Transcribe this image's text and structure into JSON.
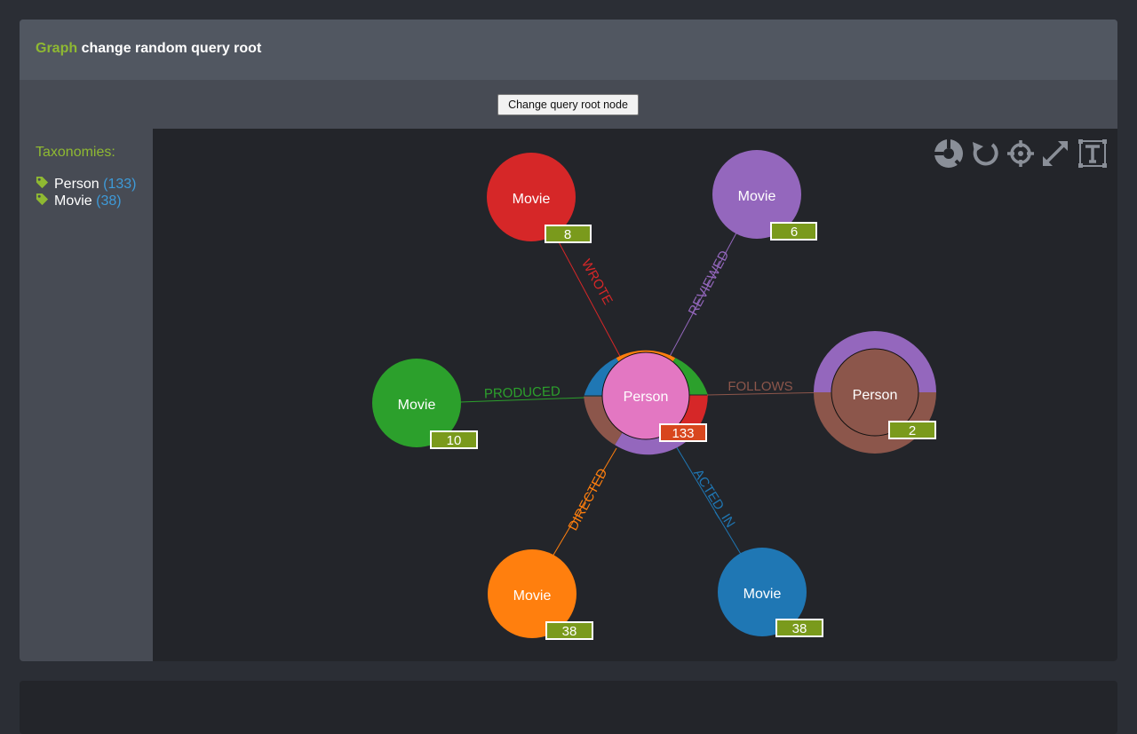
{
  "header": {
    "title_accent": "Graph",
    "title_rest": " change random query root"
  },
  "toolbar": {
    "change_root_label": "Change query root node"
  },
  "sidebar": {
    "title": "Taxonomies:",
    "items": [
      {
        "label": "Person",
        "count": "(133)"
      },
      {
        "label": "Movie",
        "count": "(38)"
      }
    ]
  },
  "colors": {
    "accent": "#8fb932",
    "count_link": "#3e9ad8",
    "badge": "#7a9a1c",
    "badge_root": "#d8461e",
    "red": "#d62728",
    "purple": "#9467bd",
    "green": "#2ca02c",
    "orange": "#ff7f0e",
    "blue": "#1f77b4",
    "brown": "#8c564b",
    "pink": "#e377c2"
  },
  "graph_controls": [
    "center-root-icon",
    "reset-icon",
    "locate-icon",
    "fullscreen-icon",
    "toggle-labels-icon"
  ],
  "graph": {
    "root": {
      "label": "Person",
      "count": "133"
    },
    "nodes": [
      {
        "label": "Movie",
        "count": "8",
        "color": "red"
      },
      {
        "label": "Movie",
        "count": "6",
        "color": "purple"
      },
      {
        "label": "Movie",
        "count": "10",
        "color": "green"
      },
      {
        "label": "Person",
        "count": "2",
        "color": "brown"
      },
      {
        "label": "Movie",
        "count": "38",
        "color": "orange"
      },
      {
        "label": "Movie",
        "count": "38",
        "color": "blue"
      }
    ],
    "relations": [
      {
        "label": "WROTE",
        "color": "red"
      },
      {
        "label": "REVIEWED",
        "color": "purple"
      },
      {
        "label": "PRODUCED",
        "color": "green"
      },
      {
        "label": "FOLLOWS",
        "color": "brown"
      },
      {
        "label": "DIRECTED",
        "color": "orange"
      },
      {
        "label": "ACTED_IN",
        "color": "blue"
      }
    ]
  }
}
